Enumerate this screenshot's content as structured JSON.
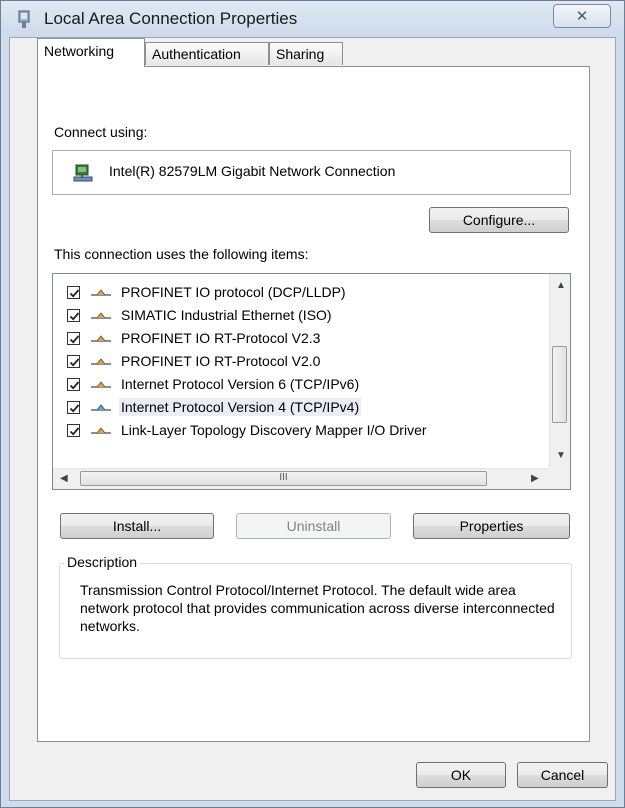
{
  "window": {
    "title": "Local Area Connection Properties",
    "close_symbol": "✕"
  },
  "tabs": [
    {
      "label": "Networking",
      "active": true
    },
    {
      "label": "Authentication",
      "active": false
    },
    {
      "label": "Sharing",
      "active": false
    }
  ],
  "connect_using": {
    "label": "Connect using:",
    "adapter_name": "Intel(R) 82579LM Gigabit Network Connection",
    "configure_label": "Configure..."
  },
  "items_section": {
    "label": "This connection uses the following items:",
    "items": [
      {
        "label": "PROFINET IO protocol (DCP/LLDP)",
        "checked": true,
        "selected": false
      },
      {
        "label": "SIMATIC Industrial Ethernet (ISO)",
        "checked": true,
        "selected": false
      },
      {
        "label": "PROFINET IO RT-Protocol V2.3",
        "checked": true,
        "selected": false
      },
      {
        "label": "PROFINET IO RT-Protocol V2.0",
        "checked": true,
        "selected": false
      },
      {
        "label": "Internet Protocol Version 6 (TCP/IPv6)",
        "checked": true,
        "selected": false
      },
      {
        "label": "Internet Protocol Version 4 (TCP/IPv4)",
        "checked": true,
        "selected": true
      },
      {
        "label": "Link-Layer Topology Discovery Mapper I/O Driver",
        "checked": true,
        "selected": false
      }
    ],
    "hscroll_grip": "III"
  },
  "buttons": {
    "install": "Install...",
    "uninstall": "Uninstall",
    "properties": "Properties",
    "ok": "OK",
    "cancel": "Cancel"
  },
  "description": {
    "title": "Description",
    "text": "Transmission Control Protocol/Internet Protocol. The default wide area network protocol that provides communication across diverse interconnected networks."
  },
  "icons": {
    "title": "network-card-icon",
    "adapter": "network-adapter-icon",
    "protocol": "protocol-icon"
  },
  "colors": {
    "frame": "#cfdcec",
    "selection": "#e9eef5"
  }
}
